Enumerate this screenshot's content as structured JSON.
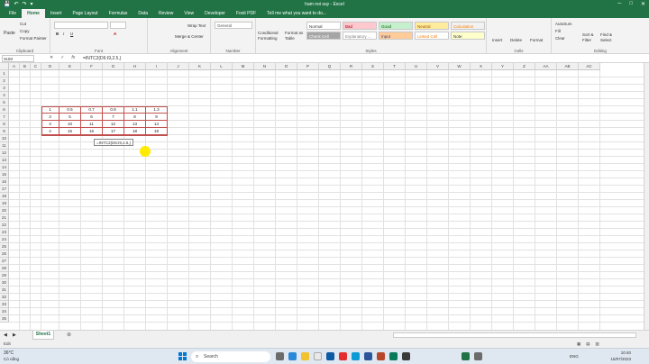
{
  "window": {
    "title": "ham noi suy - Excel",
    "quick_access": [
      "💾",
      "↶",
      "↷",
      "▾"
    ],
    "controls": [
      "─",
      "□",
      "✕"
    ]
  },
  "tabs": [
    {
      "label": "File",
      "active": false
    },
    {
      "label": "Home",
      "active": true
    },
    {
      "label": "Insert",
      "active": false
    },
    {
      "label": "Page Layout",
      "active": false
    },
    {
      "label": "Formulas",
      "active": false
    },
    {
      "label": "Data",
      "active": false
    },
    {
      "label": "Review",
      "active": false
    },
    {
      "label": "View",
      "active": false
    },
    {
      "label": "Developer",
      "active": false
    },
    {
      "label": "Foxit PDF",
      "active": false
    }
  ],
  "tell_me": "Tell me what you want to do...",
  "ribbon": {
    "clipboard": {
      "label": "Clipboard",
      "paste": "Paste",
      "cut": "Cut",
      "copy": "Copy",
      "format_painter": "Format Painter"
    },
    "font": {
      "label": "Font",
      "font_name": "",
      "font_size": ""
    },
    "alignment": {
      "label": "Alignment",
      "wrap": "Wrap Text",
      "merge": "Merge & Center"
    },
    "number": {
      "label": "Number",
      "format": "General"
    },
    "styles": {
      "label": "Styles",
      "cond": "Conditional Formatting",
      "table": "Format as Table",
      "items": [
        {
          "label": "Normal",
          "bg": "#ffffff",
          "fg": "#333333"
        },
        {
          "label": "Bad",
          "bg": "#ffc7ce",
          "fg": "#9c0006"
        },
        {
          "label": "Good",
          "bg": "#c6efce",
          "fg": "#006100"
        },
        {
          "label": "Neutral",
          "bg": "#ffeb9c",
          "fg": "#9c5700"
        },
        {
          "label": "Calculation",
          "bg": "#f2f2f2",
          "fg": "#fa7d00"
        },
        {
          "label": "Check Cell",
          "bg": "#a5a5a5",
          "fg": "#ffffff"
        },
        {
          "label": "Explanatory ...",
          "bg": "#ffffff",
          "fg": "#7f7f7f"
        },
        {
          "label": "Input",
          "bg": "#ffcc99",
          "fg": "#3f3f76"
        },
        {
          "label": "Linked Cell",
          "bg": "#ffffff",
          "fg": "#fa7d00"
        },
        {
          "label": "Note",
          "bg": "#ffffcc",
          "fg": "#333333"
        }
      ]
    },
    "cells": {
      "label": "Cells",
      "insert": "Insert",
      "delete": "Delete",
      "format": "Format"
    },
    "editing": {
      "label": "Editing",
      "autosum": "AutoSum",
      "fill": "Fill",
      "clear": "Clear",
      "sort": "Sort & Filter",
      "find": "Find & Select"
    }
  },
  "formula_bar": {
    "name_box": "SUM",
    "formula": "=INTC2(D6:I9,2.5,)"
  },
  "columns": [
    "A",
    "B",
    "C",
    "D",
    "E",
    "F",
    "G",
    "H",
    "I",
    "J",
    "K",
    "L",
    "M",
    "N",
    "O",
    "P",
    "Q",
    "R",
    "S",
    "T",
    "U",
    "V",
    "W",
    "X",
    "Y",
    "Z",
    "AA",
    "AB",
    "AC"
  ],
  "rows": [
    "1",
    "2",
    "3",
    "4",
    "5",
    "6",
    "7",
    "8",
    "9",
    "10",
    "11",
    "12",
    "13",
    "14",
    "15",
    "16",
    "17",
    "18",
    "19",
    "20",
    "21",
    "22",
    "23",
    "24",
    "25",
    "26",
    "27",
    "28",
    "29",
    "30",
    "31",
    "32",
    "33",
    "34",
    "35"
  ],
  "table": [
    [
      "1",
      "0.5",
      "0.7",
      "0.9",
      "1.1",
      "1.3"
    ],
    [
      "3",
      "5",
      "6",
      "7",
      "8",
      "9"
    ],
    [
      "3",
      "10",
      "11",
      "12",
      "13",
      "14"
    ],
    [
      "4",
      "15",
      "16",
      "17",
      "18",
      "19"
    ]
  ],
  "editing_cell": "=INTC2(D6:I9,2.5,)",
  "sheet": {
    "name": "Sheet1",
    "add": "⊕"
  },
  "status": {
    "mode": "Edit"
  },
  "taskbar": {
    "weather_temp": "36°C",
    "weather_desc": "Có nắng",
    "search": "Search",
    "lang": "ENG",
    "time": "10:40",
    "date": "15/07/2023"
  }
}
